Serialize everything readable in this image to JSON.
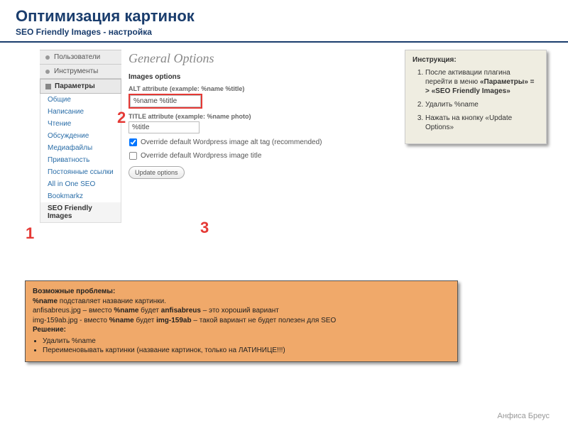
{
  "header": {
    "title": "Оптимизация картинок",
    "subtitle": "SEO Friendly Images - настройка"
  },
  "sidebar": {
    "top": [
      {
        "label": "Пользователи",
        "icon": "users-icon"
      },
      {
        "label": "Инструменты",
        "icon": "tools-icon"
      }
    ],
    "active": {
      "label": "Параметры",
      "icon": "settings-icon"
    },
    "sub": [
      "Общие",
      "Написание",
      "Чтение",
      "Обсуждение",
      "Медиафайлы",
      "Приватность",
      "Постоянные ссылки",
      "All in One SEO",
      "Bookmarkz",
      "SEO Friendly Images"
    ],
    "selected": "SEO Friendly Images"
  },
  "panel": {
    "title": "General Options",
    "section": "Images options",
    "alt_label": "ALT attribute (example: %name %title)",
    "alt_value": "%name %title",
    "title_label": "TITLE attribute (example: %name photo)",
    "title_value": "%title",
    "check1": "Override default Wordpress image alt tag (recommended)",
    "check2": "Override default Wordpress image title",
    "button": "Update options"
  },
  "markers": {
    "m1": "1",
    "m2": "2",
    "m3": "3"
  },
  "instructions": {
    "title": "Инструкция:",
    "items": [
      {
        "pre": "После активации плагина перейти в меню ",
        "b": "«Параметры» = > «SEO Friendly Images»"
      },
      {
        "pre": "Удалить %name",
        "b": ""
      },
      {
        "pre": "Нажать на кнопку «Update Options»",
        "b": ""
      }
    ]
  },
  "problems": {
    "title": "Возможные проблемы:",
    "line1a": "%name",
    "line1b": " подставляет название картинки.",
    "line2a": "anfisabreus.jpg – вместо ",
    "line2b": "%name",
    "line2c": " будет ",
    "line2d": "anfisabreus",
    "line2e": " – это хороший вариант",
    "line3a": "img-159ab.jpg - вместо ",
    "line3b": "%name",
    "line3c": " будет  ",
    "line3d": "img-159ab",
    "line3e": " – такой вариант не будет полезен для SEO",
    "solution_label": "Решение:",
    "bullets": [
      "Удалить %name",
      "Переименовывать картинки (название картинок, только на ЛАТИНИЦЕ!!!)"
    ]
  },
  "credit": "Анфиса Бреус"
}
